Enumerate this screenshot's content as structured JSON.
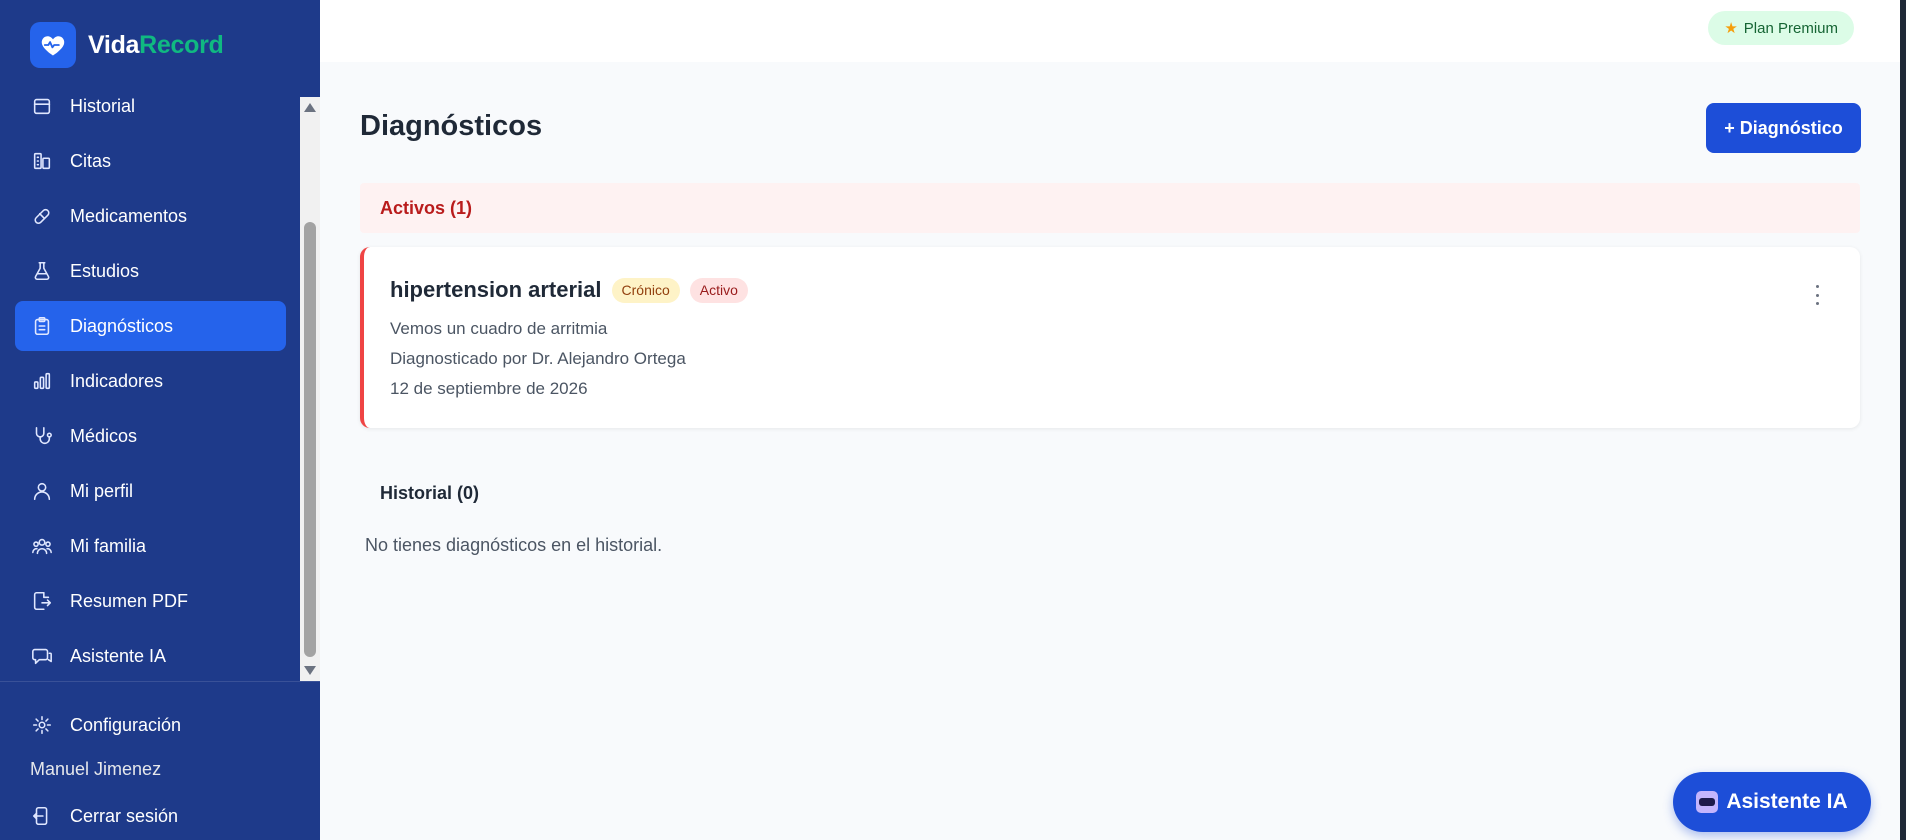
{
  "brand": {
    "name_part1": "Vida",
    "name_part2": "Record"
  },
  "sidebar": {
    "items": [
      {
        "label": "Historial",
        "icon": "calendar-icon"
      },
      {
        "label": "Citas",
        "icon": "building-icon"
      },
      {
        "label": "Medicamentos",
        "icon": "pill-icon"
      },
      {
        "label": "Estudios",
        "icon": "flask-icon"
      },
      {
        "label": "Diagnósticos",
        "icon": "clipboard-icon",
        "active": true
      },
      {
        "label": "Indicadores",
        "icon": "bar-chart-icon"
      },
      {
        "label": "Médicos",
        "icon": "stethoscope-icon"
      },
      {
        "label": "Mi perfil",
        "icon": "user-icon"
      },
      {
        "label": "Mi familia",
        "icon": "users-icon"
      },
      {
        "label": "Resumen PDF",
        "icon": "file-export-icon"
      },
      {
        "label": "Asistente IA",
        "icon": "chat-icon"
      }
    ],
    "settings_label": "Configuración",
    "user_name": "Manuel Jimenez",
    "logout_label": "Cerrar sesión"
  },
  "topbar": {
    "plan_label": "Plan Premium"
  },
  "main": {
    "title": "Diagnósticos",
    "add_button_label": "+ Diagnóstico",
    "active_section_label": "Activos (1)",
    "diagnosis": {
      "title": "hipertension arterial",
      "badge_type": "Crónico",
      "badge_status": "Activo",
      "description": "Vemos un cuadro de arritmia",
      "doctor": "Diagnosticado por Dr. Alejandro Ortega",
      "date": "12 de septiembre de 2026"
    },
    "history_section_label": "Historial (0)",
    "history_empty_text": "No tienes diagnósticos en el historial."
  },
  "assistant_fab_label": "Asistente IA",
  "colors": {
    "sidebar_bg": "#1e3a8a",
    "accent": "#2563eb",
    "brand_green": "#10b981",
    "danger": "#ef4444"
  }
}
